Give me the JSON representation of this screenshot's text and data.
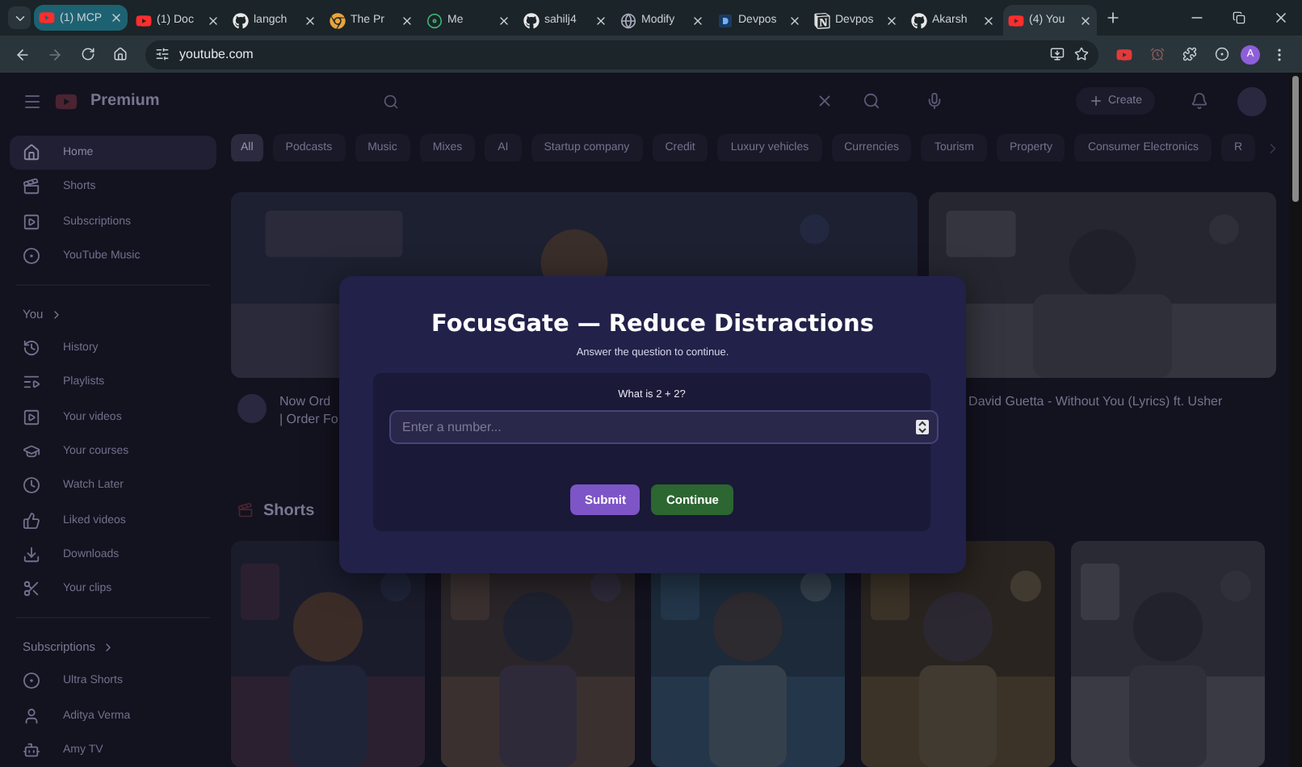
{
  "browser": {
    "tabs": [
      {
        "title": "(1) MCP",
        "kind": "youtube",
        "highlighted": true,
        "selected": false
      },
      {
        "title": "(1) Doc",
        "kind": "youtube",
        "highlighted": false,
        "selected": false
      },
      {
        "title": "langch",
        "kind": "github",
        "highlighted": false,
        "selected": false
      },
      {
        "title": "The Pr",
        "kind": "chrome",
        "highlighted": false,
        "selected": false
      },
      {
        "title": "Me",
        "kind": "meet",
        "highlighted": false,
        "selected": false
      },
      {
        "title": "sahilj4",
        "kind": "github",
        "highlighted": false,
        "selected": false
      },
      {
        "title": "Modify",
        "kind": "globe",
        "highlighted": false,
        "selected": false
      },
      {
        "title": "Devpos",
        "kind": "devpost",
        "highlighted": false,
        "selected": false
      },
      {
        "title": "Devpos",
        "kind": "notion",
        "highlighted": false,
        "selected": false
      },
      {
        "title": "Akarsh",
        "kind": "github",
        "highlighted": false,
        "selected": false
      },
      {
        "title": "(4) You",
        "kind": "youtube",
        "highlighted": false,
        "selected": true
      }
    ],
    "address": "youtube.com",
    "profile_initial": "A"
  },
  "youtube": {
    "logo_text": "Premium",
    "create_label": "Create",
    "sidebar": {
      "main": [
        {
          "label": "Home",
          "selected": true
        },
        {
          "label": "Shorts",
          "selected": false
        },
        {
          "label": "Subscriptions",
          "selected": false
        },
        {
          "label": "YouTube Music",
          "selected": false
        }
      ],
      "you_heading": "You",
      "you": [
        {
          "label": "History",
          "selected": false
        },
        {
          "label": "Playlists",
          "selected": false
        },
        {
          "label": "Your videos",
          "selected": false
        },
        {
          "label": "Your courses",
          "selected": false
        },
        {
          "label": "Watch Later",
          "selected": false
        },
        {
          "label": "Liked videos",
          "selected": false
        },
        {
          "label": "Downloads",
          "selected": false
        },
        {
          "label": "Your clips",
          "selected": false
        }
      ],
      "subscriptions_heading": "Subscriptions",
      "subscriptions": [
        {
          "label": "Ultra Shorts",
          "selected": false
        },
        {
          "label": "Aditya Verma",
          "selected": false
        },
        {
          "label": "Amy TV",
          "selected": false
        }
      ]
    },
    "chips": [
      {
        "label": "All",
        "selected": true
      },
      {
        "label": "Podcasts",
        "selected": false
      },
      {
        "label": "Music",
        "selected": false
      },
      {
        "label": "Mixes",
        "selected": false
      },
      {
        "label": "AI",
        "selected": false
      },
      {
        "label": "Startup company",
        "selected": false
      },
      {
        "label": "Credit",
        "selected": false
      },
      {
        "label": "Luxury vehicles",
        "selected": false
      },
      {
        "label": "Currencies",
        "selected": false
      },
      {
        "label": "Tourism",
        "selected": false
      },
      {
        "label": "Property",
        "selected": false
      },
      {
        "label": "Consumer Electronics",
        "selected": false
      },
      {
        "label": "R",
        "selected": false
      }
    ],
    "videos": [
      {
        "title_lines": [
          "Now Ord",
          "| Order Fo"
        ]
      },
      {
        "title_lines": [
          "David Guetta - Without You (Lyrics) ft. Usher"
        ]
      }
    ],
    "shorts_heading": "Shorts"
  },
  "dialog": {
    "title": "FocusGate — Reduce Distractions",
    "subtitle": "Answer the question to continue.",
    "question": "What is 2 + 2?",
    "placeholder": "Enter a number...",
    "buttons": [
      {
        "label": "Submit",
        "kind": "primary"
      },
      {
        "label": "Continue",
        "kind": "success"
      }
    ]
  }
}
